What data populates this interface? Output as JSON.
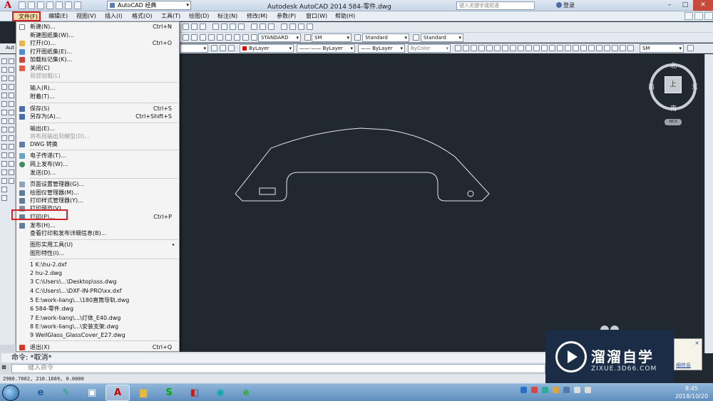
{
  "titlebar": {
    "workspace": "AutoCAD 经典",
    "title": "Autodesk AutoCAD 2014    584-零件.dwg",
    "search_placeholder": "键入关键字或短语",
    "login": "登录"
  },
  "menubar": {
    "items": [
      "文件(F)",
      "编辑(E)",
      "视图(V)",
      "插入(I)",
      "格式(O)",
      "工具(T)",
      "绘图(D)",
      "标注(N)",
      "修改(M)",
      "参数(P)",
      "窗口(W)",
      "帮助(H)"
    ]
  },
  "toolbar": {
    "text_style": "STANDARD",
    "dim_style": "SM",
    "table_style": "Standard",
    "mleader_style": "Standard",
    "color": "ByLayer",
    "linetype": "ByLayer",
    "lineweight": "ByLayer",
    "plotstyle": "ByColor",
    "dim_style_2": "SM",
    "left_strip": "Aut"
  },
  "file_menu": {
    "items": [
      {
        "label": "新建(N)...",
        "shortcut": "Ctrl+N",
        "disabled": false,
        "icon_color": "#ffffff"
      },
      {
        "label": "新建图纸集(W)...",
        "shortcut": "",
        "disabled": false,
        "icon_color": ""
      },
      {
        "label": "打开(O)...",
        "shortcut": "Ctrl+O",
        "disabled": false,
        "icon_color": "#e5b84a"
      },
      {
        "label": "打开图纸集(E)...",
        "shortcut": "",
        "disabled": false,
        "icon_color": "#4c8ed1"
      },
      {
        "label": "加载标记集(K)...",
        "shortcut": "",
        "disabled": false,
        "icon_color": "#c9483e"
      },
      {
        "label": "关闭(C)",
        "shortcut": "",
        "disabled": false,
        "icon_color": "#e35b4a"
      },
      {
        "label": "局部加载(L)",
        "shortcut": "",
        "disabled": true,
        "icon_color": ""
      },
      {
        "label": "输入(R)...",
        "shortcut": "",
        "disabled": false,
        "icon_color": ""
      },
      {
        "label": "附着(T)...",
        "shortcut": "",
        "disabled": false,
        "icon_color": ""
      },
      {
        "label": "保存(S)",
        "shortcut": "Ctrl+S",
        "disabled": false,
        "icon_color": "#4a6fa8"
      },
      {
        "label": "另存为(A)...",
        "shortcut": "Ctrl+Shift+S",
        "disabled": false,
        "icon_color": "#4a6fa8"
      },
      {
        "label": "输出(E)...",
        "shortcut": "",
        "disabled": false,
        "icon_color": ""
      },
      {
        "label": "将布局输出到模型(D)...",
        "shortcut": "",
        "disabled": true,
        "icon_color": ""
      },
      {
        "label": "DWG 转换",
        "shortcut": "",
        "disabled": false,
        "icon_color": "#5b7fa8"
      },
      {
        "label": "电子传递(T)...",
        "shortcut": "",
        "disabled": false,
        "icon_color": "#6aa3c7"
      },
      {
        "label": "网上发布(W)...",
        "shortcut": "",
        "disabled": false,
        "icon_color": "#3f8f5a"
      },
      {
        "label": "发送(D)...",
        "shortcut": "",
        "disabled": false,
        "icon_color": ""
      },
      {
        "label": "页面设置管理器(G)...",
        "shortcut": "",
        "disabled": false,
        "icon_color": "#8fa3b8"
      },
      {
        "label": "绘图仪管理器(M)...",
        "shortcut": "",
        "disabled": false,
        "icon_color": "#5f7fa0"
      },
      {
        "label": "打印样式管理器(Y)...",
        "shortcut": "",
        "disabled": false,
        "icon_color": "#5f7fa0"
      },
      {
        "label": "打印预览(V)",
        "shortcut": "",
        "disabled": false,
        "icon_color": "#7e8da0"
      },
      {
        "label": "打印(P)...",
        "shortcut": "Ctrl+P",
        "disabled": false,
        "icon_color": "#5f7fa0"
      },
      {
        "label": "发布(H)...",
        "shortcut": "",
        "disabled": false,
        "icon_color": "#5f7fa0"
      },
      {
        "label": "查看打印和发布详细信息(B)...",
        "shortcut": "",
        "disabled": false,
        "icon_color": ""
      },
      {
        "label": "图形实用工具(U)",
        "shortcut": "",
        "disabled": false,
        "icon_color": "",
        "submenu": true
      },
      {
        "label": "图形特性(I)...",
        "shortcut": "",
        "disabled": false,
        "icon_color": ""
      },
      {
        "label": "1 K:\\hu-2.dxf",
        "shortcut": "",
        "disabled": false,
        "icon_color": ""
      },
      {
        "label": "2 hu-2.dwg",
        "shortcut": "",
        "disabled": false,
        "icon_color": ""
      },
      {
        "label": "3 C:\\Users\\...\\Desktop\\sss.dwg",
        "shortcut": "",
        "disabled": false,
        "icon_color": ""
      },
      {
        "label": "4 C:\\Users\\...\\DXF-IN-PRO\\xx.dxf",
        "shortcut": "",
        "disabled": false,
        "icon_color": ""
      },
      {
        "label": "5 E:\\work-liang\\...\\180直筒导轨.dwg",
        "shortcut": "",
        "disabled": false,
        "icon_color": ""
      },
      {
        "label": "6 584-零件.dwg",
        "shortcut": "",
        "disabled": false,
        "icon_color": ""
      },
      {
        "label": "7 E:\\work-liang\\...\\灯体_E40.dwg",
        "shortcut": "",
        "disabled": false,
        "icon_color": ""
      },
      {
        "label": "8 E:\\work-liang\\...\\安装支架.dwg",
        "shortcut": "",
        "disabled": false,
        "icon_color": ""
      },
      {
        "label": "9 WellGlass_GlassCover_E27.dwg",
        "shortcut": "",
        "disabled": false,
        "icon_color": ""
      },
      {
        "label": "退出(X)",
        "shortcut": "Ctrl+Q",
        "disabled": false,
        "icon_color": "#d03a2f"
      }
    ]
  },
  "viewcube": {
    "north": "北",
    "south": "南",
    "east": "东",
    "west": "西",
    "top": "上",
    "wcs": "WCS"
  },
  "command": {
    "history": "命令: *取消*",
    "placeholder": "键入命令"
  },
  "coords": "2986.7002, 210.1669, 0.0000",
  "watermark": {
    "brand": "溜溜自学",
    "url": "ZIXUE.3D66.COM",
    "side_link": "细信息"
  },
  "clock": {
    "time": "8:45",
    "date": "2018/10/20"
  }
}
